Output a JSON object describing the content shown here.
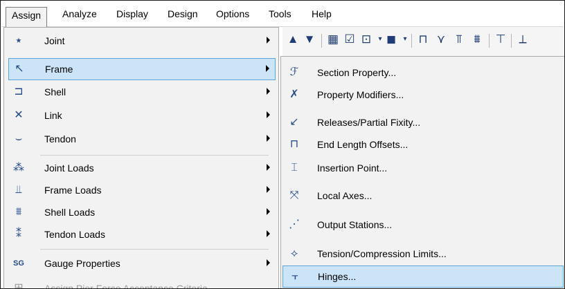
{
  "menubar": {
    "items": [
      "Assign",
      "Analyze",
      "Display",
      "Design",
      "Options",
      "Tools",
      "Help"
    ]
  },
  "toolbar": {
    "icons": [
      "up-arrow-icon",
      "down-arrow-icon",
      "grid-icon",
      "checkbox-icon",
      "frame-icon",
      "dropdown-icon",
      "cube-icon",
      "dropdown-icon",
      "portal-frame-icon",
      "link-icon",
      "beam-icon",
      "loads-icon",
      "column-icon",
      "truss-icon"
    ]
  },
  "assign_menu": {
    "items": [
      {
        "label": "Joint",
        "icon": "joint-icon",
        "submenu": true
      },
      {
        "label": "Frame",
        "icon": "frame-icon",
        "submenu": true,
        "highlighted": true
      },
      {
        "label": "Shell",
        "icon": "shell-icon",
        "submenu": true
      },
      {
        "label": "Link",
        "icon": "link-icon",
        "submenu": true
      },
      {
        "label": "Tendon",
        "icon": "tendon-icon",
        "submenu": true
      },
      {
        "label": "Joint Loads",
        "icon": "joint-loads-icon",
        "submenu": true
      },
      {
        "label": "Frame Loads",
        "icon": "frame-loads-icon",
        "submenu": true
      },
      {
        "label": "Shell Loads",
        "icon": "shell-loads-icon",
        "submenu": true
      },
      {
        "label": "Tendon Loads",
        "icon": "tendon-loads-icon",
        "submenu": true
      },
      {
        "label": "Gauge Properties",
        "icon": "gauge-icon",
        "submenu": true
      },
      {
        "label": "Assign Pier Force Acceptance Criteria...",
        "icon": "pier-icon",
        "submenu": false,
        "disabled": true
      }
    ]
  },
  "frame_submenu": {
    "items": [
      {
        "label": "Section Property...",
        "icon": "section-property-icon"
      },
      {
        "label": "Property Modifiers...",
        "icon": "property-modifiers-icon"
      },
      {
        "label": "Releases/Partial Fixity...",
        "icon": "releases-icon"
      },
      {
        "label": "End Length Offsets...",
        "icon": "end-offsets-icon"
      },
      {
        "label": "Insertion Point...",
        "icon": "insertion-point-icon"
      },
      {
        "label": "Local Axes...",
        "icon": "local-axes-icon"
      },
      {
        "label": "Output Stations...",
        "icon": "output-stations-icon"
      },
      {
        "label": "Tension/Compression Limits...",
        "icon": "tension-compression-icon"
      },
      {
        "label": "Hinges...",
        "icon": "hinges-icon",
        "highlighted": true
      }
    ]
  }
}
